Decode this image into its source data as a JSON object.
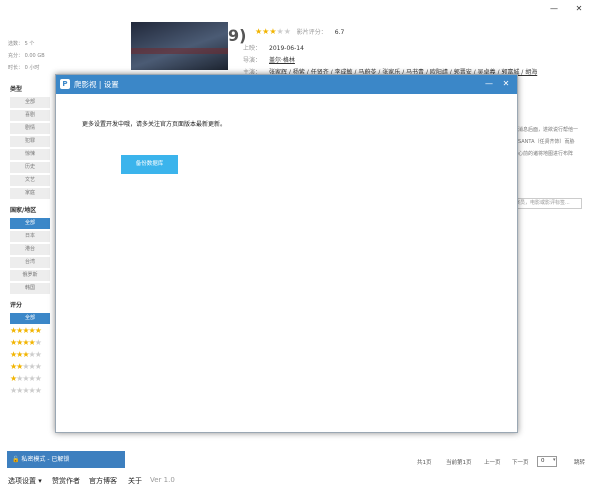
{
  "window": {
    "minimize": "—",
    "close": "✕"
  },
  "left_panel": {
    "stats": [
      {
        "label": "选数：",
        "value": "5",
        "unit": "个"
      },
      {
        "label": "充分：",
        "value": "0.00",
        "unit": "GB"
      },
      {
        "label": "时长：",
        "value": "0",
        "unit": "小时"
      }
    ],
    "type_title": "类型",
    "types": [
      "全部",
      "喜剧",
      "剧情",
      "犯罪",
      "惊悚",
      "历史",
      "文艺",
      "家庭"
    ],
    "region_title": "国家/地区",
    "regions": [
      "全部",
      "日本",
      "港台",
      "台湾",
      "俄罗斯",
      "韩国"
    ],
    "rating_title": "评分",
    "rating_all": "全部",
    "rating_stars": [
      5,
      4,
      3,
      2,
      1,
      0
    ]
  },
  "movie": {
    "title": "9)",
    "rating_label": "影片评分：",
    "rating_value": "6.7",
    "rating_stars": 3,
    "release_label": "上映：",
    "release_value": "2019-06-14",
    "director_label": "导演：",
    "director_value": "盖尔·格林",
    "cast_label": "主演：",
    "cast_value": "张家辉 / 杨紫 / 任贤齐 / 李成敏 / 马蔚苓 / 张家乐 / 马书青 / 欧阳靖 / 郭晋安 / 吴卓羲 / 郭富城 / 胡海",
    "desc_lines": [
      "消息后面，遂欲说行帮他一",
      "SANTA（任贤齐饰）而胁",
      "心前的诸将地图进行布阵"
    ],
    "search_placeholder": "演员，电影或影评标签..."
  },
  "dialog": {
    "logo": "P",
    "title": "爬影视 | 设置",
    "minimize": "—",
    "close": "✕",
    "message": "更多设置开发中哦，请多关注官方页面版本最新更新。",
    "action_label": "备份数据库"
  },
  "footer": {
    "privacy": "私密模式 - 已解锁",
    "total_pages": "共1页",
    "current_page": "当前第1页",
    "prev": "上一页",
    "next": "下一页",
    "page_input": "0",
    "jump": "跳转"
  },
  "menu": [
    "选项设置 ▾",
    "赞赏作者",
    "官方博客",
    "关于",
    "Ver 1.0"
  ],
  "colors": {
    "accent": "#3b87c8",
    "action": "#3bb4ec",
    "star": "#f2b400"
  }
}
